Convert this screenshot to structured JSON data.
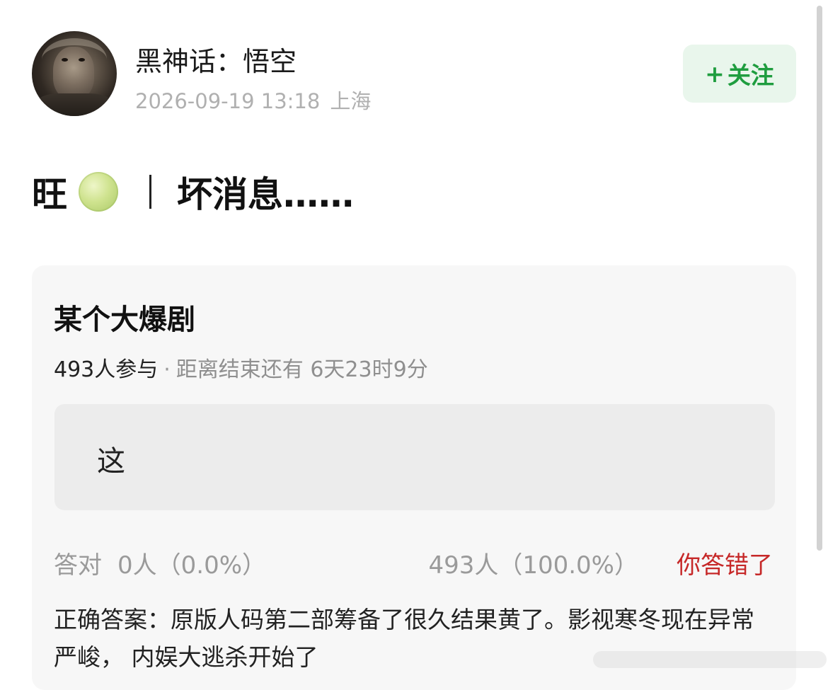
{
  "author": {
    "name": "黑神话：悟空",
    "timestamp": "2026-09-19 13:18",
    "location": "上海"
  },
  "follow_button": {
    "plus": "+",
    "label": "关注"
  },
  "post": {
    "title_prefix": "旺",
    "title_icon": "melon-emoji",
    "title_text": "坏消息……"
  },
  "quiz": {
    "title": "某个大爆剧",
    "participants": "493人参与",
    "separator": "·",
    "deadline": "距离结束还有 6天23时9分",
    "option_text": "这",
    "correct_label": "答对",
    "correct_value": "0人（0.0%）",
    "wrong_value": "493人（100.0%）",
    "wrong_label": "你答错了",
    "answer": "正确答案：原版人码第二部筹备了很久结果黄了。影视寒冬现在异常严峻， 内娱大逃杀开始了"
  },
  "colors": {
    "follow_green": "#1f9d3f",
    "wrong_red": "#c62828",
    "meta_gray": "#b0b0b0"
  }
}
